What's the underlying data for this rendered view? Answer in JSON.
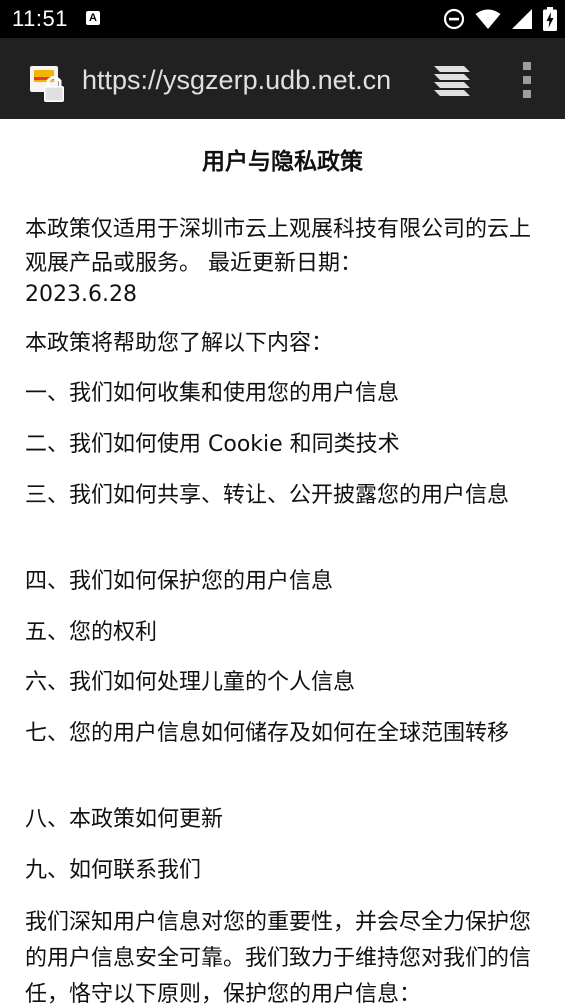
{
  "status_bar": {
    "time": "11:51",
    "notification_glyph": "A",
    "icons": [
      "dnd-icon",
      "wifi-icon",
      "signal-icon",
      "battery-charging-icon"
    ]
  },
  "browser": {
    "url": "https://ysgzerp.udb.net.cn",
    "site_icon": "lock-icon",
    "tabs_icon": "tabs-stack-icon",
    "menu_icon": "overflow-menu-icon"
  },
  "page": {
    "title": "用户与隐私政策",
    "intro_text": "本政策仅适用于深圳市云上观展科技有限公司的云上观展产品或服务。 最近更新日期：",
    "intro_date": "2023.6.28",
    "help_text": "本政策将帮助您了解以下内容：",
    "toc": [
      "一、我们如何收集和使用您的用户信息",
      "二、我们如何使用 Cookie 和同类技术",
      "三、我们如何共享、转让、公开披露您的用户信息",
      "四、我们如何保护您的用户信息",
      "五、您的权利",
      "六、我们如何处理儿童的个人信息",
      "七、您的用户信息如何储存及如何在全球范围转移",
      "八、本政策如何更新",
      "九、如何联系我们"
    ],
    "closing_text": "我们深知用户信息对您的重要性，并会尽全力保护您的用户信息安全可靠。我们致力于维持您对我们的信任，恪守以下原则，保护您的用户信息："
  },
  "colors": {
    "status_bar_bg": "#000000",
    "url_bar_bg": "#212121",
    "url_text": "#e0e0e0",
    "page_bg": "#ffffff",
    "body_text": "#111111"
  }
}
